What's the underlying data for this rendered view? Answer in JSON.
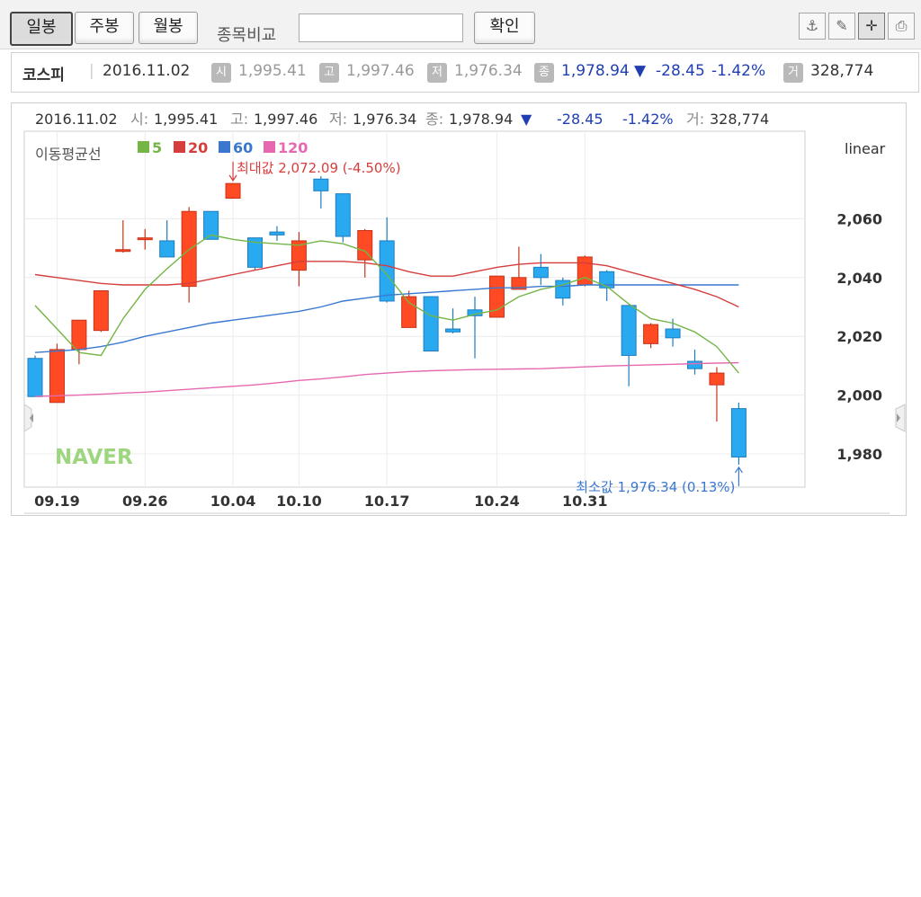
{
  "toolbar": {
    "tabs": [
      "일봉",
      "주봉",
      "월봉"
    ],
    "compare_label": "종목비교",
    "compare_placeholder": "",
    "confirm_label": "확인",
    "tool_icons": [
      "indicator-icon",
      "draw-icon",
      "crosshair-icon",
      "print-icon"
    ]
  },
  "summary": {
    "name": "코스피",
    "date": "2016.11.02",
    "open_badge": "시",
    "open": "1,995.41",
    "high_badge": "고",
    "high": "1,997.46",
    "low_badge": "저",
    "low": "1,976.34",
    "close_badge": "종",
    "close": "1,978.94",
    "change_arrow": "▼",
    "change": "-28.45",
    "change_pct": "-1.42%",
    "volume_badge": "거",
    "volume": "328,774"
  },
  "colors": {
    "up": "#ff4a23",
    "down": "#29aaf0",
    "ma5": "#74b546",
    "ma20": "#d63d3d",
    "ma60": "#3a78d0",
    "ma120": "#e668b0",
    "down_text": "#1f3fb0"
  },
  "chart_data": {
    "type": "candlestick",
    "header": {
      "date": "2016.11.02",
      "open_label": "시:",
      "open": "1,995.41",
      "high_label": "고:",
      "high": "1,997.46",
      "low_label": "저:",
      "low": "1,976.34",
      "close_label": "종:",
      "close": "1,978.94",
      "arrow": "▼",
      "change": "-28.45",
      "change_pct": "-1.42%",
      "volume_label": "거:",
      "volume": "328,774"
    },
    "scale_label": "linear",
    "ma_title": "이동평균선",
    "legend": [
      {
        "name": "5",
        "color": "#74b546"
      },
      {
        "name": "20",
        "color": "#d63d3d"
      },
      {
        "name": "60",
        "color": "#3a78d0"
      },
      {
        "name": "120",
        "color": "#e668b0"
      }
    ],
    "ylim": [
      1970,
      2080
    ],
    "y_ticks": [
      1980,
      2000,
      2020,
      2040,
      2060
    ],
    "y_tick_labels": [
      "1,980",
      "2,000",
      "2,020",
      "2,040",
      "2,060"
    ],
    "x_labels": [
      {
        "i": 1,
        "label": "09.19"
      },
      {
        "i": 5,
        "label": "09.26"
      },
      {
        "i": 9,
        "label": "10.04"
      },
      {
        "i": 12,
        "label": "10.10"
      },
      {
        "i": 16,
        "label": "10.17"
      },
      {
        "i": 21,
        "label": "10.24"
      },
      {
        "i": 25,
        "label": "10.31"
      }
    ],
    "candles": [
      {
        "o": 2012.5,
        "h": 2013.5,
        "l": 1999.5,
        "c": 1999.5
      },
      {
        "o": 1997.5,
        "h": 2017.5,
        "l": 1997.5,
        "c": 2015.5
      },
      {
        "o": 2015.5,
        "h": 2025.5,
        "l": 2010.5,
        "c": 2025.5
      },
      {
        "o": 2022.0,
        "h": 2035.5,
        "l": 2021.5,
        "c": 2035.5
      },
      {
        "o": 2049.5,
        "h": 2059.5,
        "l": 2048.5,
        "c": 2049.5
      },
      {
        "o": 2053.0,
        "h": 2056.5,
        "l": 2049.5,
        "c": 2053.5
      },
      {
        "o": 2052.5,
        "h": 2059.5,
        "l": 2047.0,
        "c": 2047.0
      },
      {
        "o": 2037.0,
        "h": 2064.0,
        "l": 2031.5,
        "c": 2062.5
      },
      {
        "o": 2062.5,
        "h": 2062.5,
        "l": 2053.0,
        "c": 2053.0
      },
      {
        "o": 2067.0,
        "h": 2072.0,
        "l": 2067.0,
        "c": 2072.0
      },
      {
        "o": 2053.5,
        "h": 2053.5,
        "l": 2042.5,
        "c": 2043.5
      },
      {
        "o": 2055.5,
        "h": 2057.5,
        "l": 2052.5,
        "c": 2054.5
      },
      {
        "o": 2042.5,
        "h": 2055.5,
        "l": 2037.0,
        "c": 2052.5
      },
      {
        "o": 2073.5,
        "h": 2074.5,
        "l": 2063.5,
        "c": 2069.5
      },
      {
        "o": 2068.5,
        "h": 2068.5,
        "l": 2052.0,
        "c": 2054.0
      },
      {
        "o": 2046.0,
        "h": 2056.5,
        "l": 2040.0,
        "c": 2056.0
      },
      {
        "o": 2052.5,
        "h": 2060.5,
        "l": 2031.5,
        "c": 2032.0
      },
      {
        "o": 2023.0,
        "h": 2035.5,
        "l": 2023.0,
        "c": 2033.5
      },
      {
        "o": 2033.5,
        "h": 2033.5,
        "l": 2015.0,
        "c": 2015.0
      },
      {
        "o": 2022.5,
        "h": 2029.5,
        "l": 2021.0,
        "c": 2021.5
      },
      {
        "o": 2029.0,
        "h": 2033.5,
        "l": 2012.5,
        "c": 2027.0
      },
      {
        "o": 2026.5,
        "h": 2040.5,
        "l": 2026.5,
        "c": 2040.5
      },
      {
        "o": 2036.0,
        "h": 2050.5,
        "l": 2036.0,
        "c": 2040.0
      },
      {
        "o": 2043.5,
        "h": 2048.0,
        "l": 2037.5,
        "c": 2040.0
      },
      {
        "o": 2039.0,
        "h": 2040.0,
        "l": 2030.5,
        "c": 2033.0
      },
      {
        "o": 2037.5,
        "h": 2047.5,
        "l": 2037.0,
        "c": 2047.0
      },
      {
        "o": 2042.0,
        "h": 2042.5,
        "l": 2032.0,
        "c": 2036.5
      },
      {
        "o": 2030.5,
        "h": 2030.5,
        "l": 2003.0,
        "c": 2013.5
      },
      {
        "o": 2017.5,
        "h": 2024.5,
        "l": 2016.0,
        "c": 2024.0
      },
      {
        "o": 2022.5,
        "h": 2026.0,
        "l": 2016.5,
        "c": 2019.5
      },
      {
        "o": 2011.5,
        "h": 2015.5,
        "l": 2007.0,
        "c": 2009.0
      },
      {
        "o": 2003.5,
        "h": 2009.5,
        "l": 1991.0,
        "c": 2007.5
      },
      {
        "o": 1995.41,
        "h": 1997.46,
        "l": 1976.34,
        "c": 1978.94
      }
    ],
    "ma5": [
      2030.5,
      2022.5,
      2014.5,
      2013.5,
      2026.0,
      2036.0,
      2043.0,
      2049.5,
      2054.5,
      2053.0,
      2052.0,
      2051.5,
      2051.0,
      2052.5,
      2051.5,
      2049.0,
      2041.0,
      2031.5,
      2027.0,
      2025.5,
      2027.5,
      2029.0,
      2033.5,
      2036.0,
      2037.5,
      2040.0,
      2037.0,
      2031.0,
      2026.0,
      2024.5,
      2021.5,
      2016.5,
      2007.5
    ],
    "ma20": [
      2041.0,
      2040.0,
      2039.0,
      2038.0,
      2037.5,
      2037.5,
      2037.5,
      2038.0,
      2039.5,
      2041.0,
      2042.5,
      2044.0,
      2045.5,
      2045.5,
      2045.5,
      2045.0,
      2044.0,
      2042.0,
      2040.5,
      2040.5,
      2042.0,
      2043.5,
      2044.5,
      2045.0,
      2045.0,
      2045.0,
      2044.0,
      2042.0,
      2040.0,
      2038.0,
      2036.0,
      2033.5,
      2030.0
    ],
    "ma60": [
      2014.5,
      2015.0,
      2015.5,
      2016.5,
      2018.0,
      2020.0,
      2021.5,
      2023.0,
      2024.5,
      2025.5,
      2026.5,
      2027.5,
      2028.5,
      2030.0,
      2032.0,
      2033.0,
      2034.0,
      2034.5,
      2035.0,
      2035.5,
      2036.0,
      2036.5,
      2036.5,
      2037.0,
      2037.0,
      2037.5,
      2037.5,
      2037.5,
      2037.5,
      2037.5,
      2037.5,
      2037.5,
      2037.5
    ],
    "ma120": [
      1999.5,
      1999.8,
      2000.0,
      2000.3,
      2000.7,
      2001.0,
      2001.5,
      2002.0,
      2002.5,
      2003.0,
      2003.5,
      2004.2,
      2005.0,
      2005.5,
      2006.2,
      2007.0,
      2007.5,
      2008.0,
      2008.3,
      2008.5,
      2008.7,
      2008.8,
      2008.9,
      2009.0,
      2009.3,
      2009.6,
      2009.9,
      2010.1,
      2010.3,
      2010.5,
      2010.7,
      2010.9,
      2011.0
    ],
    "annotations": {
      "max": {
        "i": 9,
        "value": 2072.09,
        "text": "최대값 2,072.09 (-4.50%)"
      },
      "min": {
        "i": 32,
        "value": 1976.34,
        "text": "최소값 1,976.34 (0.13%)"
      }
    },
    "watermark": "NAVER"
  }
}
